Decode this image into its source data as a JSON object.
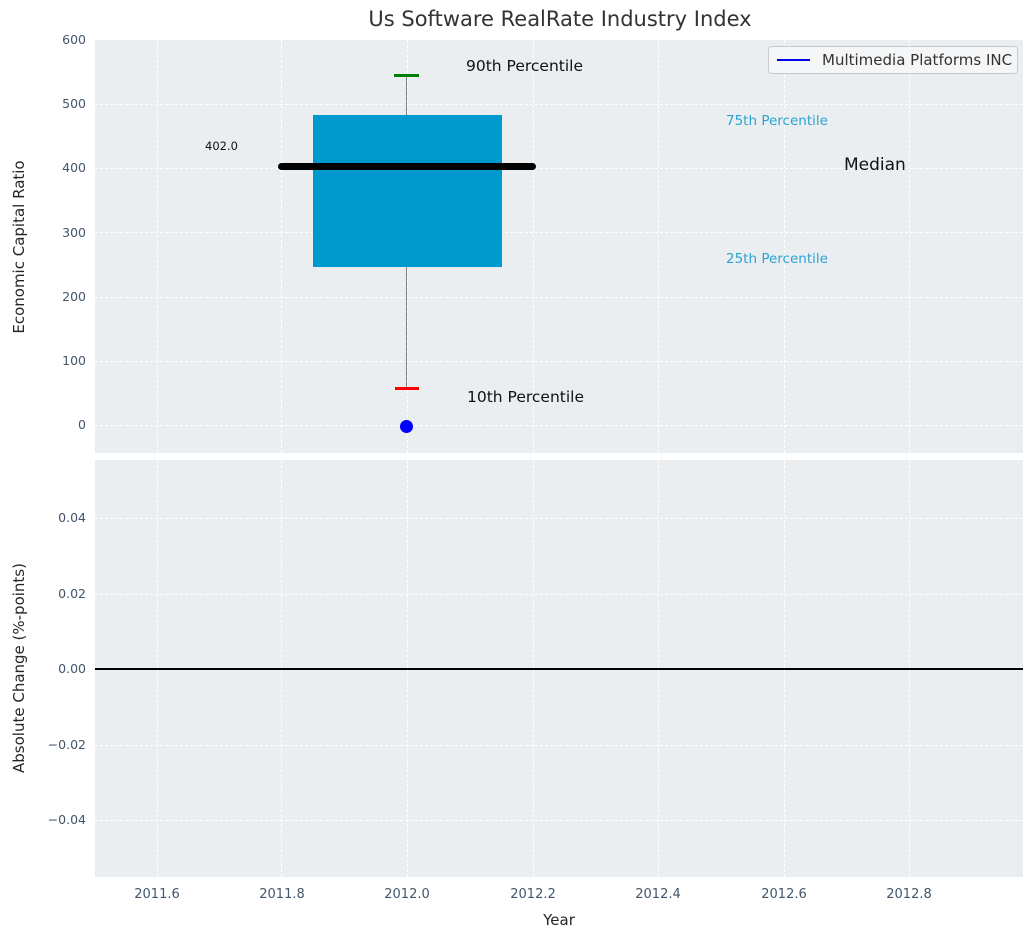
{
  "title": "Us Software RealRate Industry Index",
  "top_plot": {
    "ylabel": "Economic Capital Ratio",
    "yticks": [
      "600",
      "500",
      "400",
      "300",
      "200",
      "100",
      "0"
    ],
    "annotations": {
      "p90_label": "90th Percentile",
      "p10_label": "10th Percentile",
      "p75_label": "75th Percentile",
      "p25_label": "25th Percentile",
      "median_label": "Median",
      "median_value_label": "402.0"
    },
    "legend": {
      "label": "Multimedia Platforms INC"
    }
  },
  "bottom_plot": {
    "ylabel": "Absolute Change (%-points)",
    "yticks": [
      "0.04",
      "0.02",
      "0.00",
      "−0.02",
      "−0.04"
    ]
  },
  "xaxis": {
    "label": "Year",
    "ticks": [
      "2011.6",
      "2011.8",
      "2012.0",
      "2012.2",
      "2012.4",
      "2012.6",
      "2012.8"
    ]
  },
  "colors": {
    "box_fill": "#0099cd",
    "median_line": "#000000",
    "p90_cap": "#008000",
    "p10_cap": "#ff0000",
    "company_marker": "#0000ff",
    "legend_line": "#0000e6",
    "percentile_text": "#2aa3d2",
    "plot_background": "#ebeef0",
    "tick_text": "#43566b"
  },
  "chart_data": [
    {
      "type": "boxplot",
      "title": "Us Software RealRate Industry Index",
      "xlabel": "Year",
      "ylabel": "Economic Capital Ratio",
      "x": 2012.0,
      "box": {
        "p10": 58,
        "p25": 247,
        "median": 402.0,
        "p75": 483,
        "p90": 545
      },
      "series": [
        {
          "name": "Multimedia Platforms INC",
          "x": [
            2012.0
          ],
          "y": [
            0
          ]
        }
      ],
      "xlim": [
        2011.5,
        2013.0
      ],
      "ylim": [
        -50,
        605
      ],
      "xticks": [
        2011.6,
        2011.8,
        2012.0,
        2012.2,
        2012.4,
        2012.6,
        2012.8
      ],
      "yticks": [
        0,
        100,
        200,
        300,
        400,
        500,
        600
      ],
      "grid": true,
      "legend_position": "upper right"
    },
    {
      "type": "line",
      "xlabel": "Year",
      "ylabel": "Absolute Change (%-points)",
      "series": [],
      "zero_line": 0.0,
      "xlim": [
        2011.5,
        2013.0
      ],
      "ylim": [
        -0.055,
        0.055
      ],
      "xticks": [
        2011.6,
        2011.8,
        2012.0,
        2012.2,
        2012.4,
        2012.6,
        2012.8
      ],
      "yticks": [
        -0.04,
        -0.02,
        0.0,
        0.02,
        0.04
      ],
      "grid": true
    }
  ]
}
